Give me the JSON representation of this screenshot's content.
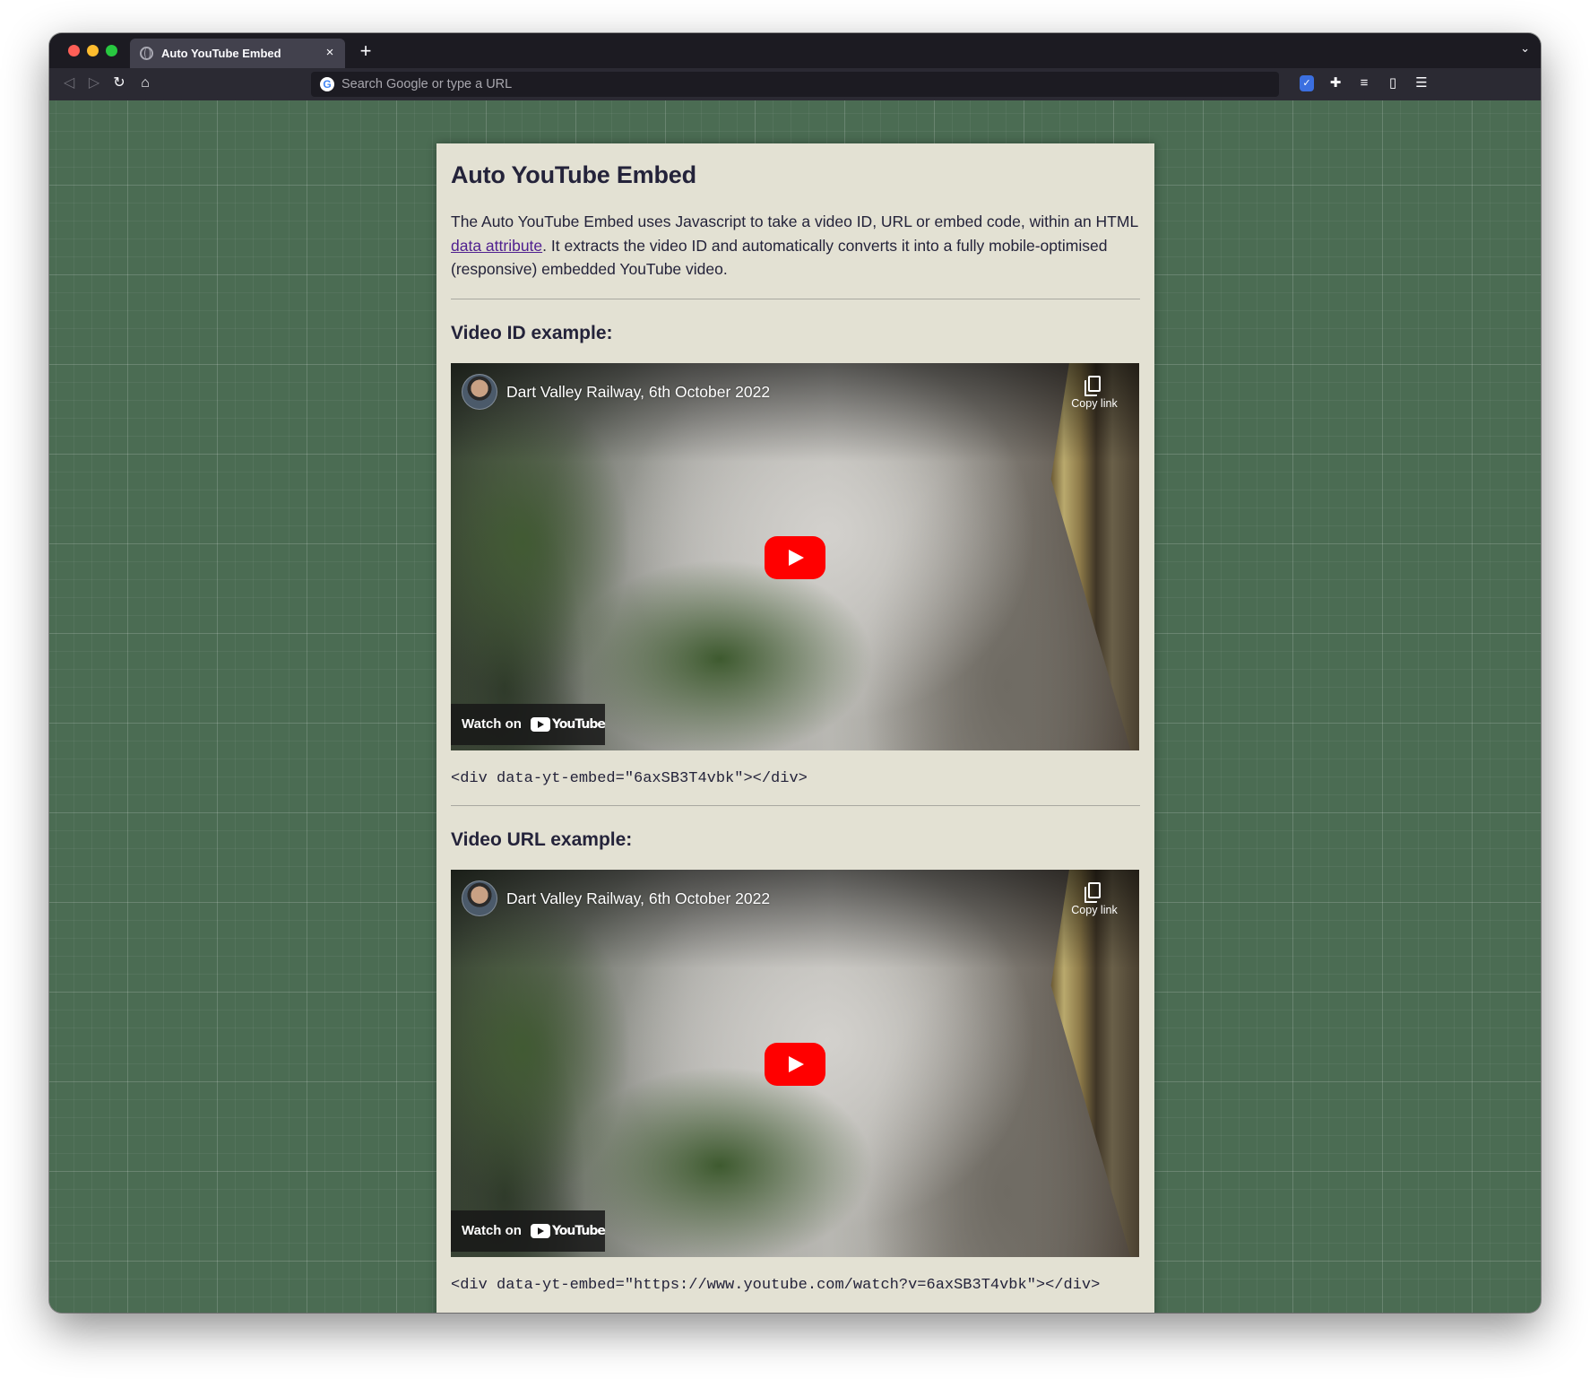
{
  "browser": {
    "tab_title": "Auto YouTube Embed",
    "tab_close": "×",
    "new_tab": "+",
    "url_placeholder": "Search Google or type a URL"
  },
  "page": {
    "title": "Auto YouTube Embed",
    "intro_before_link": "The Auto YouTube Embed uses Javascript to take a video ID, URL or embed code, within an HTML ",
    "intro_link": "data attribute",
    "intro_after_link": ". It extracts the video ID and automatically converts it into a fully mobile-optimised (responsive) embedded YouTube video.",
    "sections": [
      {
        "heading": "Video ID example:",
        "video_title": "Dart Valley Railway, 6th October 2022",
        "copy_link": "Copy link",
        "watch_on": "Watch on",
        "youtube": "YouTube",
        "code": "<div data-yt-embed=\"6axSB3T4vbk\"></div>"
      },
      {
        "heading": "Video URL example:",
        "video_title": "Dart Valley Railway, 6th October 2022",
        "copy_link": "Copy link",
        "watch_on": "Watch on",
        "youtube": "YouTube",
        "code": "<div data-yt-embed=\"https://www.youtube.com/watch?v=6axSB3T4vbk\"></div>"
      }
    ]
  },
  "colors": {
    "background_green": "#4b6c53",
    "card": "#e3e1d3",
    "text": "#24233a",
    "link": "#4f1f8f",
    "youtube_red": "#ff0000"
  }
}
